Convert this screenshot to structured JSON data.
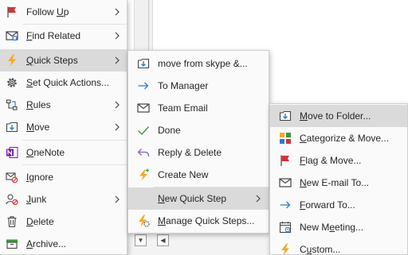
{
  "main_menu": {
    "items": [
      {
        "pre": "Follow ",
        "key": "U",
        "post": "p",
        "icon": "flag-icon"
      },
      {
        "pre": "",
        "key": "F",
        "post": "ind Related",
        "icon": "find-related-icon"
      },
      {
        "pre": "",
        "key": "Q",
        "post": "uick Steps",
        "icon": "lightning-icon"
      },
      {
        "pre": "",
        "key": "S",
        "post": "et Quick Actions...",
        "icon": "gear-icon"
      },
      {
        "pre": "",
        "key": "R",
        "post": "ules",
        "icon": "rules-icon"
      },
      {
        "pre": "",
        "key": "M",
        "post": "ove",
        "icon": "move-icon"
      },
      {
        "pre": "",
        "key": "O",
        "post": "neNote",
        "icon": "onenote-icon"
      },
      {
        "pre": "",
        "key": "I",
        "post": "gnore",
        "icon": "ignore-icon"
      },
      {
        "pre": "",
        "key": "J",
        "post": "unk",
        "icon": "junk-icon"
      },
      {
        "pre": "",
        "key": "D",
        "post": "elete",
        "icon": "delete-icon"
      },
      {
        "pre": "",
        "key": "A",
        "post": "rchive...",
        "icon": "archive-icon"
      }
    ]
  },
  "quick_steps_menu": {
    "items": [
      {
        "label": "move from skype &...",
        "icon": "move-to-folder-icon"
      },
      {
        "label": "To Manager",
        "icon": "arrow-right-icon"
      },
      {
        "label": "Team Email",
        "icon": "envelope-icon"
      },
      {
        "label": "Done",
        "icon": "checkmark-icon"
      },
      {
        "label": "Reply & Delete",
        "icon": "reply-icon"
      },
      {
        "label": "Create New",
        "icon": "lightning-new-icon"
      }
    ],
    "new_quick_step": {
      "pre": "",
      "key": "N",
      "post": "ew Quick Step"
    },
    "manage": {
      "pre": "",
      "key": "M",
      "post": "anage Quick Steps..."
    }
  },
  "new_quick_step_menu": {
    "items": [
      {
        "pre": "",
        "key": "M",
        "post": "ove to Folder...",
        "icon": "move-to-folder-icon"
      },
      {
        "pre": "",
        "key": "C",
        "post": "ategorize & Move...",
        "icon": "categorize-icon"
      },
      {
        "pre": "",
        "key": "F",
        "post": "lag & Move...",
        "icon": "flag-icon"
      },
      {
        "pre": "",
        "key": "N",
        "post": "ew E-mail To...",
        "icon": "envelope-icon"
      },
      {
        "pre": "",
        "key": "F",
        "post": "orward To...",
        "icon": "arrow-right-icon"
      },
      {
        "pre": "New M",
        "key": "e",
        "post": "eting...",
        "icon": "calendar-icon"
      },
      {
        "pre": "C",
        "key": "u",
        "post": "stom...",
        "icon": "lightning-icon"
      }
    ]
  },
  "colors": {
    "highlight": "#dadada",
    "flag_red": "#d13438",
    "lightning_orange": "#f7a825",
    "accent_blue": "#2b7cd3",
    "onenote_purple": "#7719aa",
    "done_green": "#3a9a3a",
    "reply_purple": "#8764b8"
  }
}
